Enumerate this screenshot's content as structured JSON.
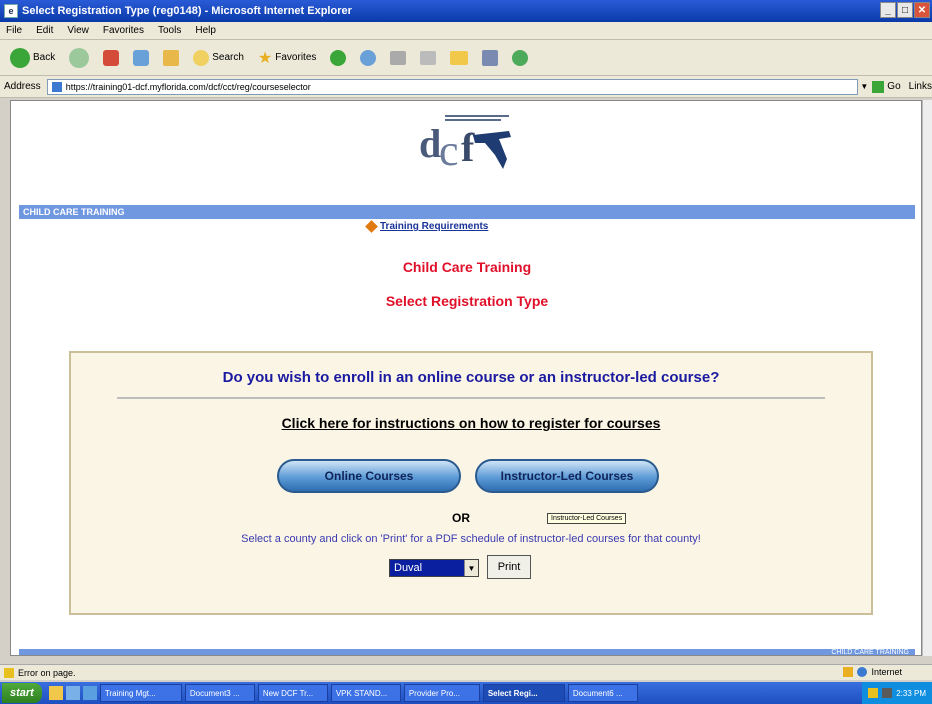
{
  "window": {
    "title": "Select Registration Type (reg0148) - Microsoft Internet Explorer",
    "controls": [
      "_",
      "□",
      "✕"
    ]
  },
  "menubar": [
    "File",
    "Edit",
    "View",
    "Favorites",
    "Tools",
    "Help"
  ],
  "toolbar": {
    "back": "Back",
    "search": "Search",
    "favorites": "Favorites"
  },
  "address": {
    "label": "Address",
    "url": "https://training01-dcf.myflorida.com/dcf/cct/reg/courseselector",
    "go": "Go",
    "links": "Links"
  },
  "page": {
    "nav_label": "CHILD CARE TRAINING",
    "training_requirements": "Training Requirements",
    "heading1": "Child Care Training",
    "heading2": "Select Registration Type",
    "question": "Do you wish to enroll in an online course or an instructor-led course?",
    "instructions_link": "Click here for instructions on how to register for courses",
    "online_button": "Online Courses",
    "instructor_button": "Instructor-Led Courses",
    "or_text": "OR",
    "tooltip": "Instructor-Led Courses",
    "county_instructions": "Select a county and click on 'Print' for a PDF schedule of instructor-led courses for that county!",
    "county_selected": "Duval",
    "print_button": "Print",
    "footer_strip": "CHILD CARE TRAINING"
  },
  "statusbar": {
    "message": "Error on page.",
    "zone": "Internet"
  },
  "taskbar": {
    "start": "start",
    "items": [
      {
        "label": "Training Mgt...",
        "active": false
      },
      {
        "label": "Document3 ...",
        "active": false
      },
      {
        "label": "New DCF Tr...",
        "active": false
      },
      {
        "label": "VPK STAND...",
        "active": false
      },
      {
        "label": "Provider Pro...",
        "active": false
      },
      {
        "label": "Select Regi...",
        "active": true
      },
      {
        "label": "Document6 ...",
        "active": false
      }
    ],
    "clock": "2:33 PM"
  },
  "colors": {
    "nav_strip": "#6f98e0",
    "heading_red": "#e0102a",
    "question_blue": "#1a1aa0",
    "panel_bg": "#fbf5e6"
  }
}
